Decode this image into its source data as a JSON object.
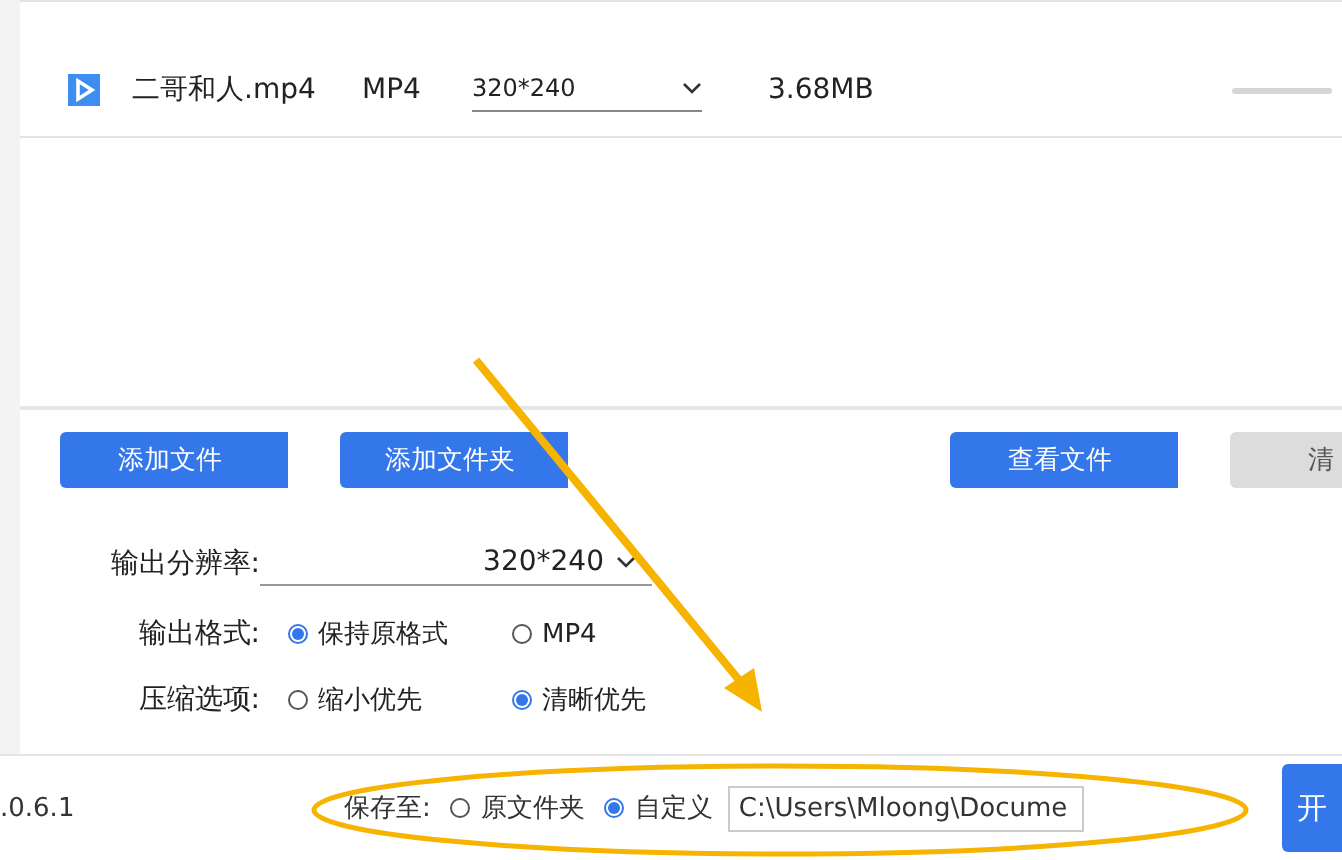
{
  "files": [
    {
      "name": "二哥和人.mp4",
      "format": "MP4",
      "resolution": "320*240",
      "size": "3.68MB"
    }
  ],
  "buttons": [
    {
      "label": "添加文件",
      "kind": "primary"
    },
    {
      "label": "添加文件夹",
      "kind": "primary"
    },
    {
      "label": "查看文件",
      "kind": "primary"
    },
    {
      "label": "清",
      "kind": "secondary"
    }
  ],
  "resolution": {
    "label": "输出分辨率:",
    "value": "320*240"
  },
  "options": [
    {
      "label": "输出格式:",
      "choices": [
        {
          "label": "保持原格式",
          "selected": true
        },
        {
          "label": "MP4",
          "selected": false
        }
      ]
    },
    {
      "label": "压缩选项:",
      "choices": [
        {
          "label": "缩小优先",
          "selected": false
        },
        {
          "label": "清晰优先",
          "selected": true
        }
      ]
    }
  ],
  "footer": {
    "version": ".0.6.1",
    "save_label": "保存至:",
    "choices": [
      {
        "label": "原文件夹",
        "selected": false
      },
      {
        "label": "自定义",
        "selected": true
      }
    ],
    "path": "C:\\Users\\Mloong\\Docume",
    "start": "开"
  }
}
